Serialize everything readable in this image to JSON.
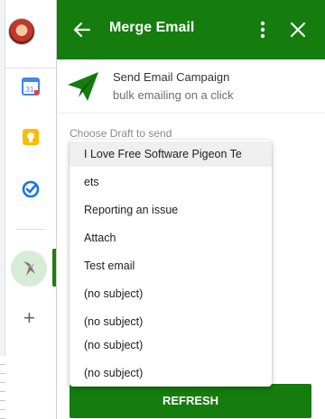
{
  "panel": {
    "title": "Merge Email",
    "campaign_title": "Send Email Campaign",
    "campaign_subtitle": "bulk emailing on a click",
    "choose_label": "Choose Draft to send",
    "refresh_label": "REFRESH"
  },
  "drafts": {
    "options": [
      "I Love Free Software Pigeon Te",
      "ets",
      "Reporting an issue",
      "Attach",
      "Test email",
      "(no subject)",
      "(no subject)",
      "(no subject)",
      "(no subject)"
    ],
    "selected": "I Love Free Software Pigeon Te"
  },
  "rail": {
    "icons": [
      "calendar-icon",
      "keep-icon",
      "tasks-icon",
      "hummingbird-addon-icon",
      "add-icon"
    ],
    "add_glyph": "+",
    "calendar_day": "31"
  },
  "colors": {
    "brand_green": "#147d0e",
    "highlight": "#efefef"
  }
}
